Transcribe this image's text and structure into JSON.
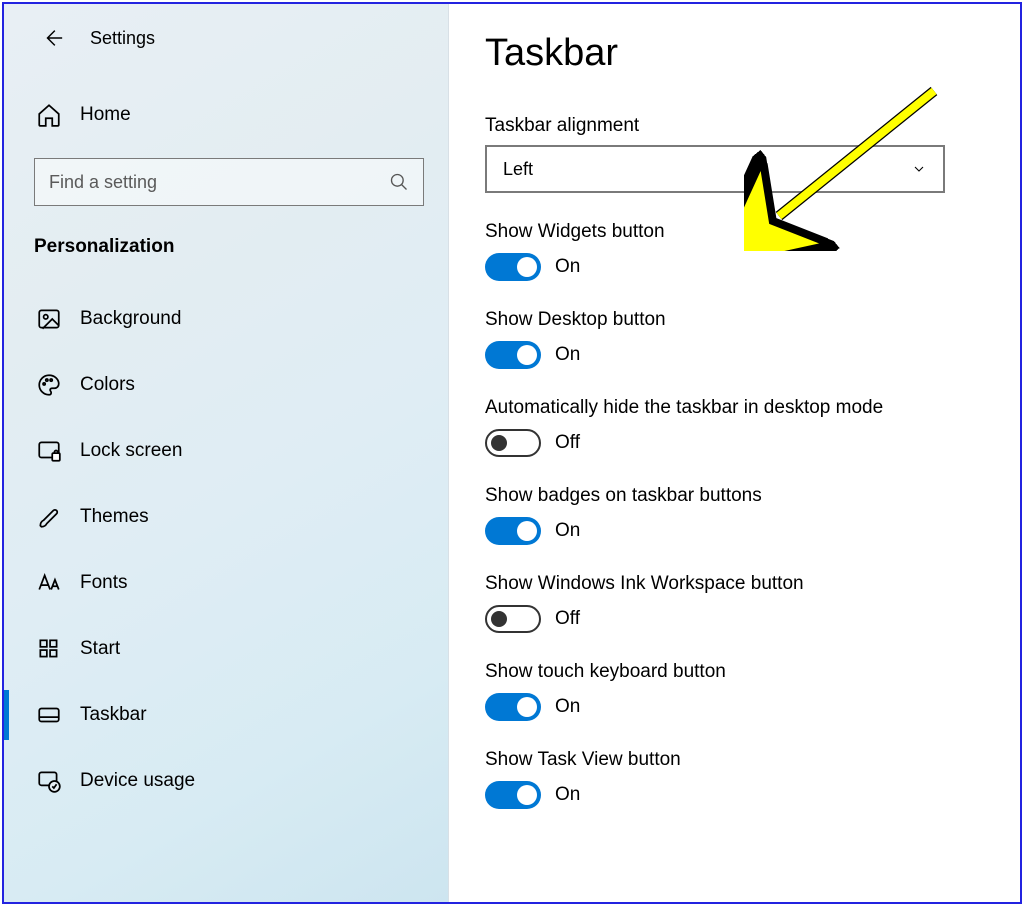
{
  "header": {
    "app_title": "Settings",
    "home_label": "Home",
    "search_placeholder": "Find a setting",
    "section_title": "Personalization"
  },
  "sidebar": {
    "items": [
      {
        "label": "Background",
        "icon": "image"
      },
      {
        "label": "Colors",
        "icon": "palette"
      },
      {
        "label": "Lock screen",
        "icon": "lock-screen"
      },
      {
        "label": "Themes",
        "icon": "brush"
      },
      {
        "label": "Fonts",
        "icon": "fonts"
      },
      {
        "label": "Start",
        "icon": "start"
      },
      {
        "label": "Taskbar",
        "icon": "taskbar",
        "active": true
      },
      {
        "label": "Device usage",
        "icon": "device-usage"
      }
    ]
  },
  "main": {
    "page_title": "Taskbar",
    "alignment": {
      "label": "Taskbar alignment",
      "value": "Left"
    },
    "toggles": [
      {
        "label": "Show Widgets button",
        "on": true,
        "text": "On"
      },
      {
        "label": "Show Desktop button",
        "on": true,
        "text": "On"
      },
      {
        "label": "Automatically hide the taskbar in desktop mode",
        "on": false,
        "text": "Off"
      },
      {
        "label": "Show badges on taskbar buttons",
        "on": true,
        "text": "On"
      },
      {
        "label": "Show Windows Ink Workspace button",
        "on": false,
        "text": "Off"
      },
      {
        "label": "Show touch keyboard button",
        "on": true,
        "text": "On"
      },
      {
        "label": "Show Task View button",
        "on": true,
        "text": "On"
      }
    ]
  }
}
